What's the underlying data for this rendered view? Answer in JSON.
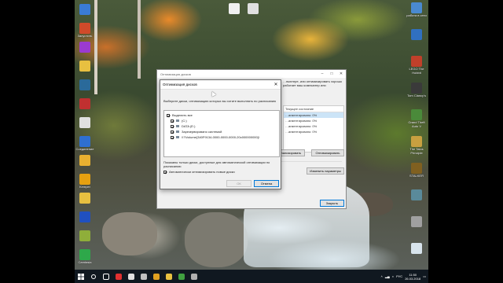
{
  "desktop": {
    "icons_left": [
      {
        "label": "",
        "icon": "recycle-bin-icon",
        "color": "#3a7bd5"
      },
      {
        "label": "Запустить",
        "icon": "app-icon",
        "color": "#d04a2a"
      },
      {
        "label": "",
        "icon": "network-icon",
        "color": "#9b3ad0"
      },
      {
        "label": "",
        "icon": "folder-icon",
        "color": "#e8c040"
      },
      {
        "label": "",
        "icon": "game-icon",
        "color": "#2a6a9a"
      },
      {
        "label": "",
        "icon": "app-icon",
        "color": "#c03030"
      },
      {
        "label": "",
        "icon": "document-icon",
        "color": "#e0e0e0"
      },
      {
        "label": "Соединение",
        "icon": "network-icon",
        "color": "#2f6fd0"
      },
      {
        "label": "",
        "icon": "folder-icon",
        "color": "#e8b030"
      },
      {
        "label": "Kemper",
        "icon": "app-icon",
        "color": "#e6a010"
      },
      {
        "label": "",
        "icon": "folder-icon",
        "color": "#e8c040"
      },
      {
        "label": "",
        "icon": "headphones-icon",
        "color": "#2050c0"
      },
      {
        "label": "",
        "icon": "app-icon",
        "color": "#8fae3a"
      },
      {
        "label": "Camtasia",
        "icon": "camtasia-icon",
        "color": "#2ea84a"
      }
    ],
    "icons_right": [
      {
        "label": "работа в сети",
        "icon": "network-icon",
        "color": "#4a8ad0"
      },
      {
        "label": "",
        "icon": "app-icon",
        "color": "#3070c0"
      },
      {
        "label": "LEGO The Hobbit",
        "icon": "game-icon",
        "color": "#c0402a"
      },
      {
        "label": "Tom Clancy's",
        "icon": "game-icon",
        "color": "#3a3a3a"
      },
      {
        "label": "Grand Theft Auto V",
        "icon": "game-icon",
        "color": "#4a8a3a"
      },
      {
        "label": "The Talos Principle",
        "icon": "game-icon",
        "color": "#c8a040"
      },
      {
        "label": "STALKER",
        "icon": "game-icon",
        "color": "#806020"
      },
      {
        "label": "",
        "icon": "app-icon",
        "color": "#5a8a9a"
      },
      {
        "label": "",
        "icon": "app-icon",
        "color": "#a0a0a0"
      },
      {
        "label": "",
        "icon": "recycle-bin-icon",
        "color": "#d8e4ec"
      }
    ],
    "icons_top": [
      {
        "label": "",
        "icon": "document-icon",
        "color": "#f0f0f0"
      },
      {
        "label": "",
        "icon": "app-icon",
        "color": "#e0e0e0"
      }
    ]
  },
  "main_window": {
    "title": "Оптимизация дисков",
    "description": "…пьютере, или оптимизировать хорошо работает ваш компьютер или",
    "status_header": "Текущее состояние",
    "status_rows": [
      "…агментировано: 0%",
      "…агментировано: 0%",
      "…агментировано: 0%",
      "…агментировано: 0%"
    ],
    "analyze_button": "Анализировать",
    "optimize_button": "Оптимизировать",
    "change_settings_button": "Изменить параметры",
    "close_button": "Закрыть"
  },
  "dialog": {
    "title": "Оптимизация дисков",
    "description": "Выберите диски, оптимизацию которых вы хотите выполнять по расписанию",
    "select_all": "Выделить все",
    "drives": [
      {
        "label": "(C:)",
        "checked": true
      },
      {
        "label": "DATA (E:)",
        "checked": true
      },
      {
        "label": "Зарезервировано системой",
        "checked": true
      },
      {
        "label": "\\\\?\\Volume{340F9134-0000-0000-0000-20c000000000}\\",
        "checked": true
      }
    ],
    "note": "Показаны только диски, доступные для автоматической оптимизации по расписанию",
    "auto_optimize_label": "Автоматически оптимизировать новые диски",
    "ok_button": "ОК",
    "cancel_button": "Отмена"
  },
  "taskbar": {
    "start_icon": "windows-start-icon",
    "language": "РУС",
    "time": "11:50",
    "date": "26.03.2018",
    "apps": [
      {
        "icon": "search-icon",
        "color": "#ffffff"
      },
      {
        "icon": "task-view-icon",
        "color": "#ffffff"
      },
      {
        "icon": "yandex-icon",
        "color": "#e03030"
      },
      {
        "icon": "browser-icon",
        "color": "#e0e0e0"
      },
      {
        "icon": "steam-icon",
        "color": "#c0c0c0"
      },
      {
        "icon": "app-icon",
        "color": "#e0a020"
      },
      {
        "icon": "folder-icon",
        "color": "#e8c040"
      },
      {
        "icon": "app-icon",
        "color": "#40a040"
      },
      {
        "icon": "settings-icon",
        "color": "#b0b0b0"
      }
    ]
  }
}
